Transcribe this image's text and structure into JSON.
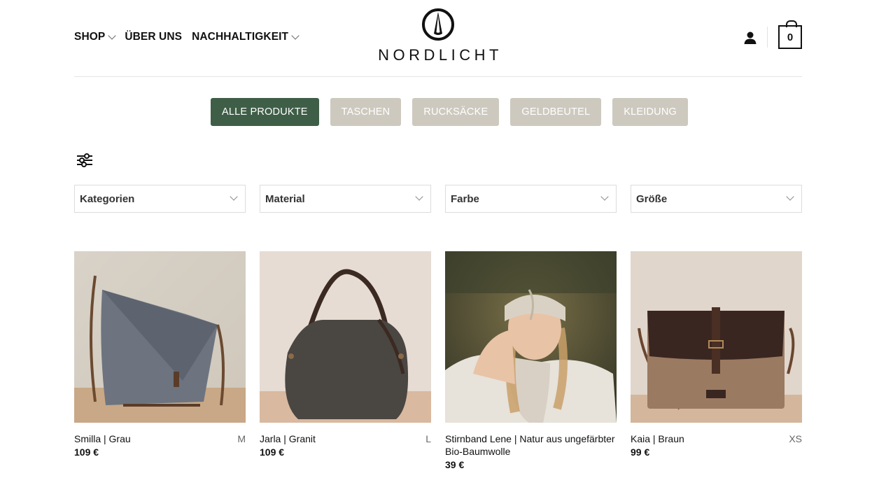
{
  "nav": {
    "items": [
      {
        "label": "SHOP",
        "has_dropdown": true
      },
      {
        "label": "ÜBER UNS",
        "has_dropdown": false
      },
      {
        "label": "NACHHALTIGKEIT",
        "has_dropdown": true
      }
    ]
  },
  "brand": {
    "name": "NORDLICHT"
  },
  "header_icons": {
    "account": "user-icon",
    "cart_count": "0"
  },
  "categories": [
    {
      "label": "ALLE PRODUKTE",
      "active": true
    },
    {
      "label": "TASCHEN",
      "active": false
    },
    {
      "label": "RUCKSÄCKE",
      "active": false
    },
    {
      "label": "GELDBEUTEL",
      "active": false
    },
    {
      "label": "KLEIDUNG",
      "active": false
    }
  ],
  "filters": [
    {
      "label": "Kategorien"
    },
    {
      "label": "Material"
    },
    {
      "label": "Farbe"
    },
    {
      "label": "Größe"
    }
  ],
  "products": [
    {
      "title": "Smilla | Grau",
      "size": "M",
      "price": "109 €",
      "image": "grey-canvas-shoulder-bag"
    },
    {
      "title": "Jarla | Granit",
      "size": "L",
      "price": "109 €",
      "image": "dark-grey-canvas-handbag"
    },
    {
      "title": "Stirnband Lene | Natur aus ungefärbter Bio-Baumwolle",
      "size": "",
      "price": "39 €",
      "image": "woman-wearing-headband"
    },
    {
      "title": "Kaia | Braun",
      "size": "XS",
      "price": "99 €",
      "image": "brown-messenger-bag"
    }
  ],
  "colors": {
    "active_category": "#3f5e47",
    "inactive_category": "#cdc9bf"
  }
}
